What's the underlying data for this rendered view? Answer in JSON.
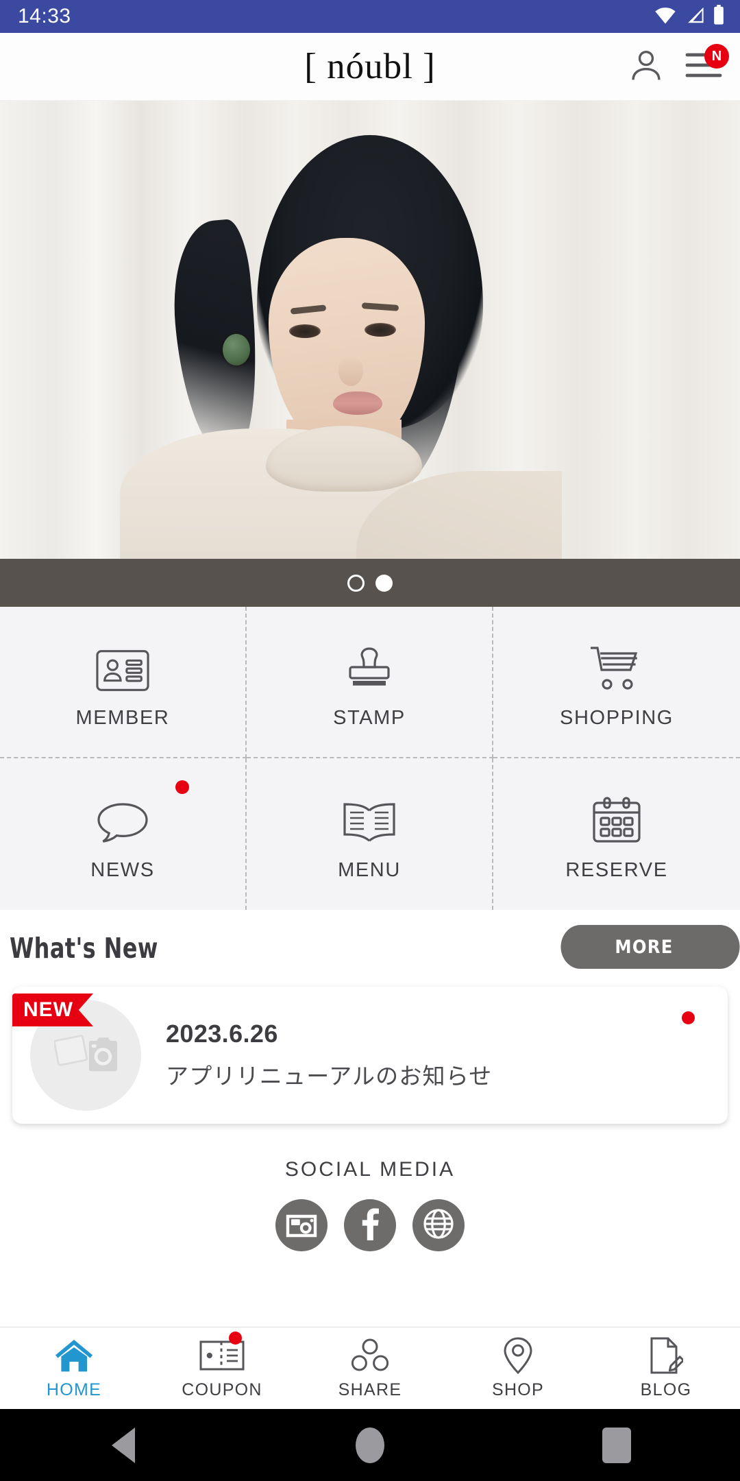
{
  "status_bar": {
    "time": "14:33",
    "background": "#3b4aa0",
    "icons": [
      "wifi-icon",
      "cellular-signal-icon",
      "battery-icon"
    ]
  },
  "header": {
    "logo": "[ nóubl ]",
    "account_icon": "person-icon",
    "menu_icon": "hamburger-menu-icon",
    "menu_badge": "N",
    "badge_color": "#e60012"
  },
  "hero": {
    "alt": "hair-model-photo",
    "carousel": {
      "slide_count": 2,
      "active_index": 1,
      "band_color": "#58524f"
    }
  },
  "menu_grid": {
    "items": [
      {
        "label": "MEMBER",
        "icon": "id-card-icon",
        "badge": false
      },
      {
        "label": "STAMP",
        "icon": "rubber-stamp-icon",
        "badge": false
      },
      {
        "label": "SHOPPING",
        "icon": "shopping-cart-icon",
        "badge": false
      },
      {
        "label": "NEWS",
        "icon": "speech-bubble-icon",
        "badge": true
      },
      {
        "label": "MENU",
        "icon": "open-book-icon",
        "badge": false
      },
      {
        "label": "RESERVE",
        "icon": "calendar-icon",
        "badge": false
      }
    ]
  },
  "whats_new": {
    "title": "What's New",
    "more_label": "MORE",
    "items": [
      {
        "ribbon": "NEW",
        "date": "2023.6.26",
        "title": "アプリリニューアルのお知らせ",
        "thumbnail": "photo-placeholder-icon",
        "unread": true
      }
    ]
  },
  "social_media": {
    "title": "SOCIAL MEDIA",
    "links": [
      {
        "name": "instagram-icon"
      },
      {
        "name": "facebook-icon"
      },
      {
        "name": "website-globe-icon"
      }
    ]
  },
  "bottom_nav": {
    "active": "HOME",
    "active_color": "#2196cf",
    "items": [
      {
        "label": "HOME",
        "icon": "home-icon",
        "active": true,
        "badge": false
      },
      {
        "label": "COUPON",
        "icon": "ticket-icon",
        "active": false,
        "badge": true
      },
      {
        "label": "SHARE",
        "icon": "share-nodes-icon",
        "active": false,
        "badge": false
      },
      {
        "label": "SHOP",
        "icon": "map-pin-icon",
        "active": false,
        "badge": false
      },
      {
        "label": "BLOG",
        "icon": "document-pencil-icon",
        "active": false,
        "badge": false
      }
    ]
  },
  "android_nav": {
    "back": "back-triangle-icon",
    "home": "home-circle-icon",
    "recents": "recents-square-icon"
  }
}
